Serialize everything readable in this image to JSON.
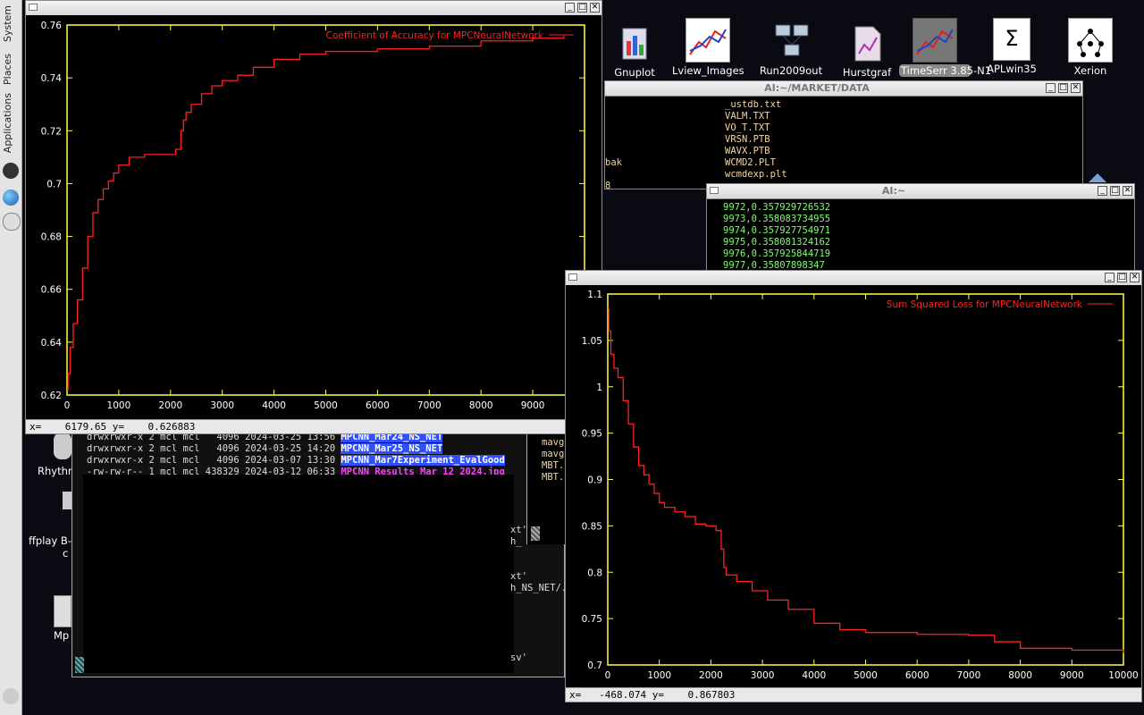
{
  "panel": {
    "system": "System",
    "places": "Places",
    "applications": "Applications"
  },
  "desktop_icons": [
    {
      "label": "Gnuplot"
    },
    {
      "label": "Lview_Images"
    },
    {
      "label": "Run2009out"
    },
    {
      "label": "Hurstgraf"
    },
    {
      "label": "TimeSerr 3.85-N1"
    },
    {
      "label": "APLwin35"
    },
    {
      "label": "Xerion"
    }
  ],
  "desktop_left_labels": {
    "rhythm": "Rhythn",
    "ffplay": "ffplay B-s",
    "ffplay2": "c",
    "mp": "Mp"
  },
  "files_window": {
    "title": "AI:~/MARKET/DATA",
    "files": [
      "_ustdb.txt",
      "VALM.TXT",
      "VO_T.TXT",
      "VRSN.PTB",
      "WAVX.PTB",
      "WCMD2.PLT",
      "wcmdexp.plt"
    ],
    "left_frag1": "bak",
    "left_frag2": "8"
  },
  "term_window": {
    "title": "AI:~",
    "lines": [
      "9972,0.357929726532",
      "9973,0.358083734955",
      "9974,0.357927754971",
      "9975,0.358081324162",
      "9976,0.357925844719",
      "9977,0.35807898347"
    ]
  },
  "ls_window": {
    "lines": [
      {
        "perm": "drwxrwxr-x 2 mcl mcl   4096 2024-03-25 13:56 ",
        "name": "MPCNN_Mar24_NS_NET"
      },
      {
        "perm": "drwxrwxr-x 2 mcl mcl   4096 2024-03-25 14:20 ",
        "name": "MPCNN_Mar25_NS_NET"
      },
      {
        "perm": "drwxrwxr-x 2 mcl mcl   4096 2024-03-07 13:30 ",
        "name": "MPCNN_Mar7Experiment_EvalGood"
      },
      {
        "perm": "-rw-rw-r-- 1 mcl mcl 438329 2024-03-12 06:33 ",
        "name": "MPCNN_Results_Mar_12_2024.jpg"
      }
    ],
    "right_frags": [
      "xt'",
      "h_",
      "xt'",
      "h_NS_NET/.",
      "sv'"
    ],
    "side_frags": [
      "mavg",
      "mavg",
      "MBT.",
      "MBT."
    ]
  },
  "chart_acc": {
    "status": "x=    6179.65 y=    0.626883",
    "chart_data": {
      "type": "line",
      "legend": "Coefficient of Accuracy for MPCNeuralNetwork",
      "legend_position": "top-right",
      "line_color": "#ff2020",
      "axis_color": "#ffff40",
      "xlim": [
        0,
        10000
      ],
      "ylim": [
        0.62,
        0.76
      ],
      "xticks": [
        "0",
        "1000",
        "2000",
        "3000",
        "4000",
        "5000",
        "6000",
        "7000",
        "8000",
        "9000"
      ],
      "yticks": [
        "0.62",
        "0.64",
        "0.66",
        "0.68",
        "0.7",
        "0.72",
        "0.74",
        "0.76"
      ],
      "x": [
        0,
        20,
        60,
        120,
        200,
        300,
        400,
        500,
        600,
        700,
        800,
        900,
        1000,
        1200,
        1500,
        1800,
        2100,
        2200,
        2250,
        2300,
        2400,
        2600,
        2800,
        3000,
        3300,
        3600,
        4000,
        4500,
        5000,
        6000,
        7000,
        8000,
        9000,
        9600
      ],
      "y": [
        0.622,
        0.628,
        0.638,
        0.647,
        0.656,
        0.668,
        0.68,
        0.689,
        0.694,
        0.698,
        0.701,
        0.704,
        0.707,
        0.71,
        0.711,
        0.711,
        0.713,
        0.72,
        0.724,
        0.727,
        0.73,
        0.734,
        0.737,
        0.739,
        0.741,
        0.744,
        0.747,
        0.749,
        0.75,
        0.751,
        0.752,
        0.754,
        0.755,
        0.756
      ]
    }
  },
  "chart_loss": {
    "status": "x=   -468.074 y=    0.867803",
    "chart_data": {
      "type": "line",
      "legend": "Sum Squared Loss for MPCNeuralNetwork",
      "legend_position": "top-right",
      "line_color": "#ff2020",
      "axis_color": "#ffff40",
      "xlim": [
        0,
        10000
      ],
      "ylim": [
        0.7,
        1.1
      ],
      "xticks": [
        "0",
        "1000",
        "2000",
        "3000",
        "4000",
        "5000",
        "6000",
        "7000",
        "8000",
        "9000",
        "10000"
      ],
      "yticks": [
        "0.7",
        "0.75",
        "0.8",
        "0.85",
        "0.9",
        "0.95",
        "1",
        "1.05",
        "1.1"
      ],
      "x": [
        0,
        20,
        60,
        120,
        200,
        300,
        400,
        500,
        600,
        700,
        800,
        900,
        1000,
        1100,
        1300,
        1500,
        1700,
        1900,
        2100,
        2200,
        2250,
        2300,
        2500,
        2800,
        3100,
        3500,
        4000,
        4500,
        5000,
        6000,
        7000,
        7500,
        8000,
        9000,
        10000
      ],
      "y": [
        1.085,
        1.06,
        1.035,
        1.02,
        1.01,
        0.985,
        0.96,
        0.935,
        0.915,
        0.905,
        0.895,
        0.885,
        0.875,
        0.87,
        0.865,
        0.86,
        0.852,
        0.85,
        0.845,
        0.825,
        0.805,
        0.797,
        0.79,
        0.78,
        0.77,
        0.76,
        0.745,
        0.738,
        0.735,
        0.733,
        0.732,
        0.725,
        0.718,
        0.716,
        0.713
      ]
    }
  }
}
